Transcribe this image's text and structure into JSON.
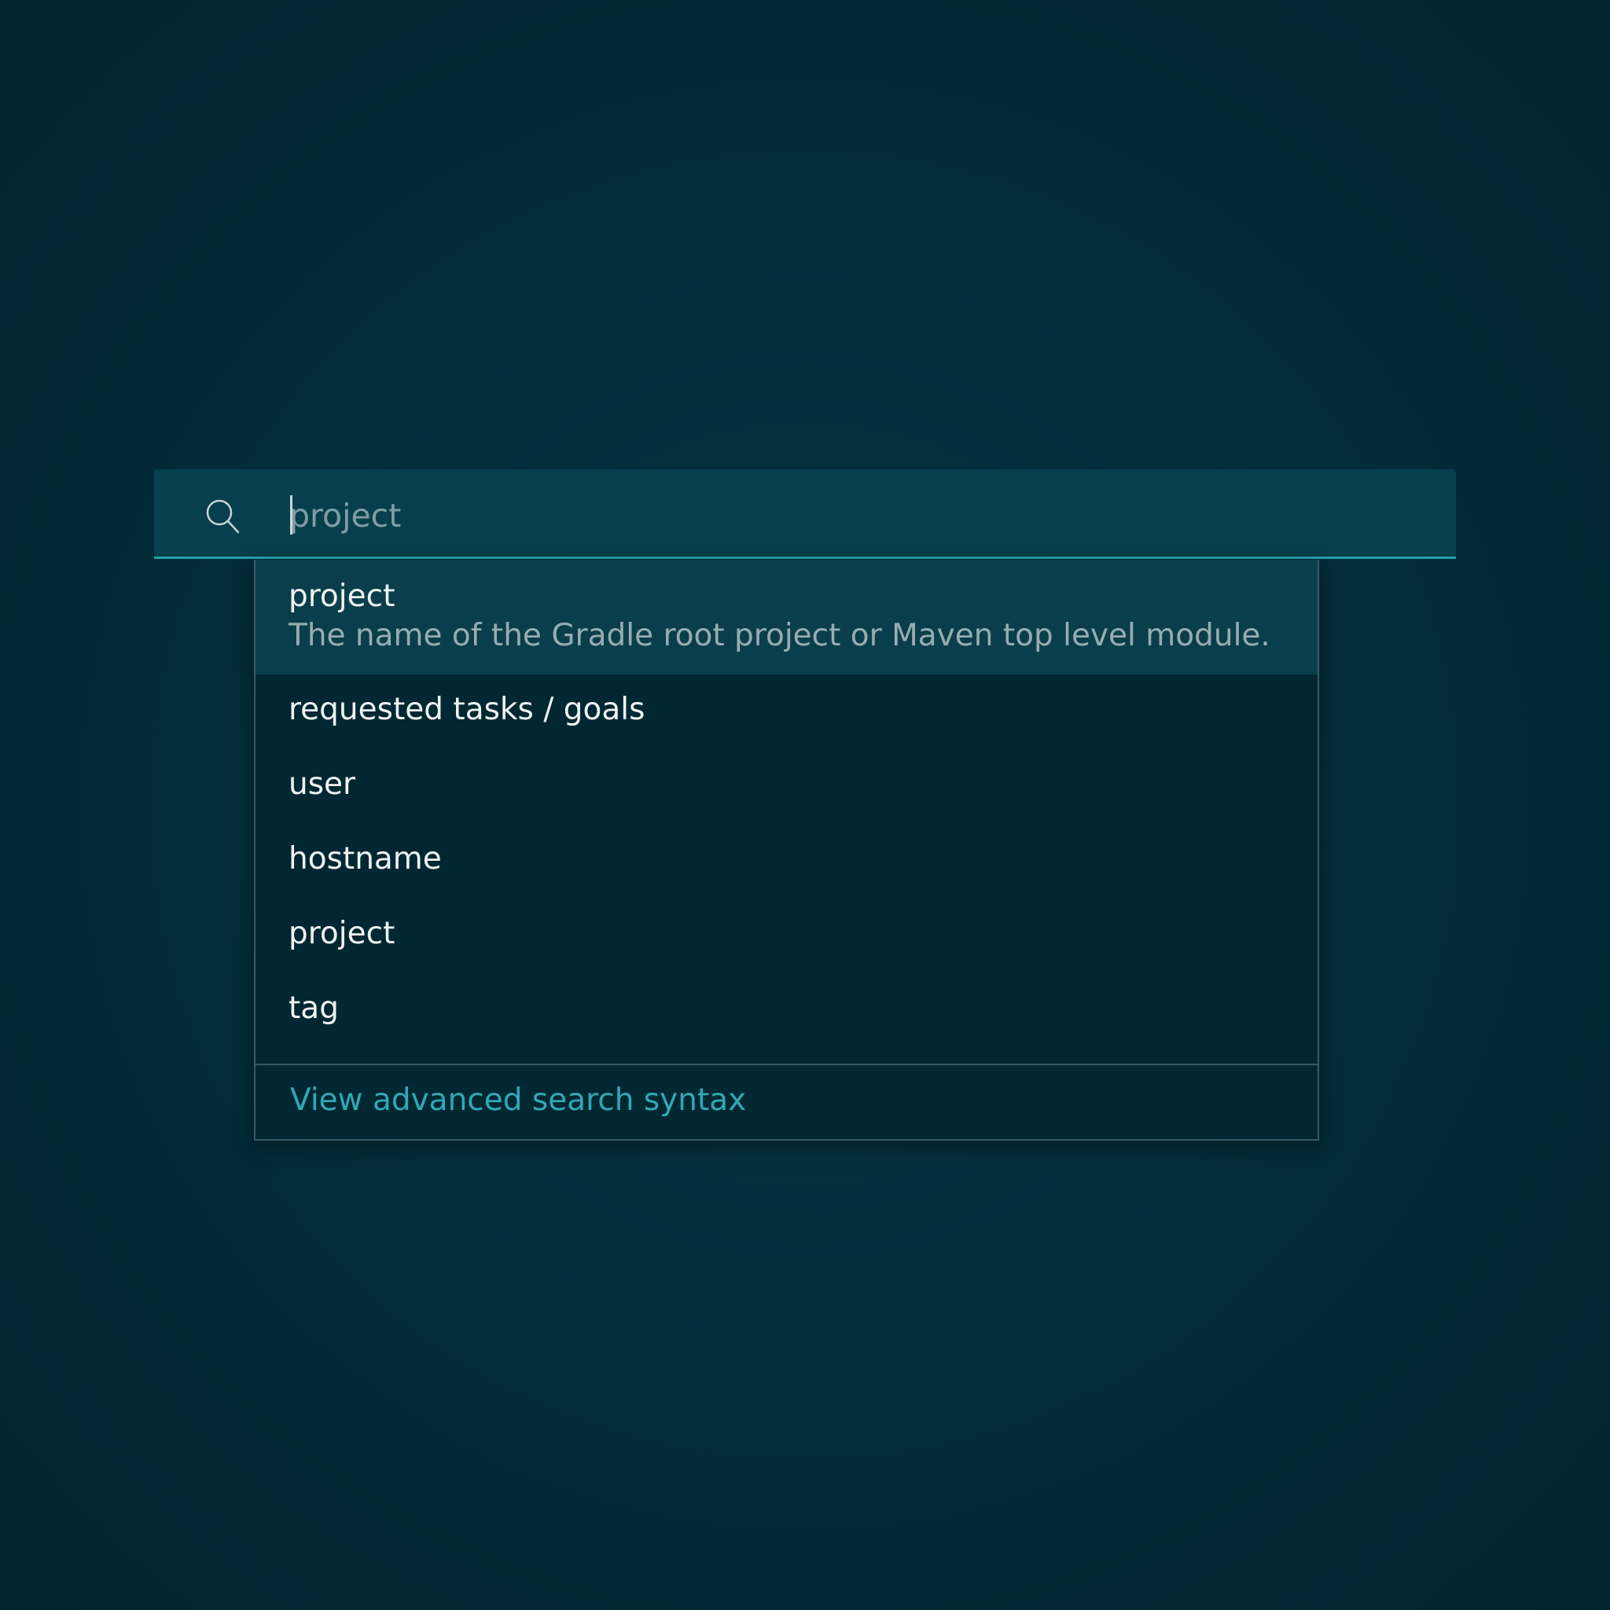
{
  "search": {
    "placeholder": "project",
    "value": "",
    "icon": "search-icon"
  },
  "dropdown": {
    "highlighted": {
      "title": "project",
      "description": "The name of the Gradle root project or Maven top level module."
    },
    "options": [
      {
        "label": "requested tasks / goals"
      },
      {
        "label": "user"
      },
      {
        "label": "hostname"
      },
      {
        "label": "project"
      },
      {
        "label": "tag"
      }
    ],
    "footer_link": "View advanced search syntax"
  },
  "colors": {
    "background": "#022a36",
    "search_bar": "#083f4c",
    "accent": "#2aa0a8",
    "link": "#2fa9b4",
    "highlight": "#0a3e4a"
  }
}
